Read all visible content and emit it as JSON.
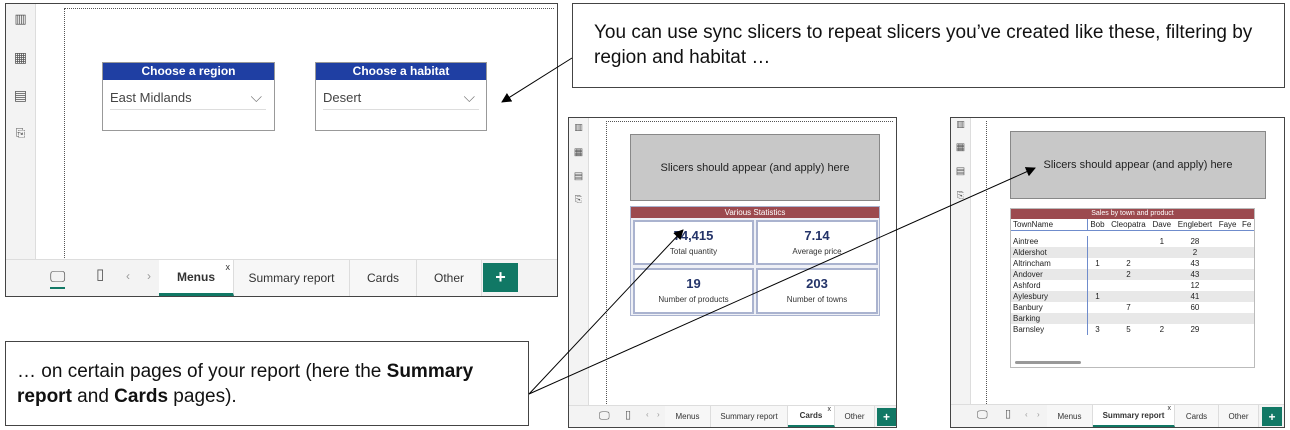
{
  "callout_top": "You can use sync slicers to repeat slicers you’ve created like these, filtering by region and habitat …",
  "callout_bottom": {
    "pre": "… on certain pages of your report (here the ",
    "b1": "Summary report",
    "mid": " and ",
    "b2": "Cards",
    "post": " pages)."
  },
  "main_screen": {
    "slicer_region": {
      "title": "Choose a region",
      "value": "East Midlands"
    },
    "slicer_habitat": {
      "title": "Choose a habitat",
      "value": "Desert"
    },
    "tabs": [
      "Menus",
      "Summary report",
      "Cards",
      "Other"
    ],
    "active_tab": "Menus",
    "add_label": "+"
  },
  "placeholder_text": "Slicers should appear (and apply) here",
  "stats_screen": {
    "title": "Various Statistics",
    "cards": [
      {
        "value": "74,415",
        "label": "Total quantity"
      },
      {
        "value": "7.14",
        "label": "Average price"
      },
      {
        "value": "19",
        "label": "Number of products"
      },
      {
        "value": "203",
        "label": "Number of towns"
      }
    ],
    "tabs": [
      "Menus",
      "Summary report",
      "Cards",
      "Other"
    ],
    "active_tab": "Cards"
  },
  "sales_screen": {
    "title": "Sales by town and product",
    "columns": [
      "TownName",
      "Bob",
      "Cleopatra",
      "Dave",
      "Englebert",
      "Faye",
      "Fe"
    ],
    "rows": [
      [
        "Aintree",
        "",
        "",
        "1",
        "28",
        "",
        ""
      ],
      [
        "Aldershot",
        "",
        "",
        "",
        "2",
        "",
        ""
      ],
      [
        "Altrincham",
        "1",
        "2",
        "",
        "43",
        "",
        ""
      ],
      [
        "Andover",
        "",
        "2",
        "",
        "43",
        "",
        ""
      ],
      [
        "Ashford",
        "",
        "",
        "",
        "12",
        "",
        ""
      ],
      [
        "Aylesbury",
        "1",
        "",
        "",
        "41",
        "",
        ""
      ],
      [
        "Banbury",
        "",
        "7",
        "",
        "60",
        "",
        ""
      ],
      [
        "Barking",
        "",
        "",
        "",
        "",
        "",
        ""
      ],
      [
        "Barnsley",
        "3",
        "5",
        "2",
        "29",
        "",
        ""
      ]
    ],
    "tabs": [
      "Menus",
      "Summary report",
      "Cards",
      "Other"
    ],
    "active_tab": "Summary report"
  },
  "tab_close": "x",
  "nav_prev": "‹",
  "nav_next": "›",
  "colors": {
    "accent_green": "#117865",
    "slicer_blue": "#1f3fa3",
    "maroon": "#9c4a4f"
  }
}
